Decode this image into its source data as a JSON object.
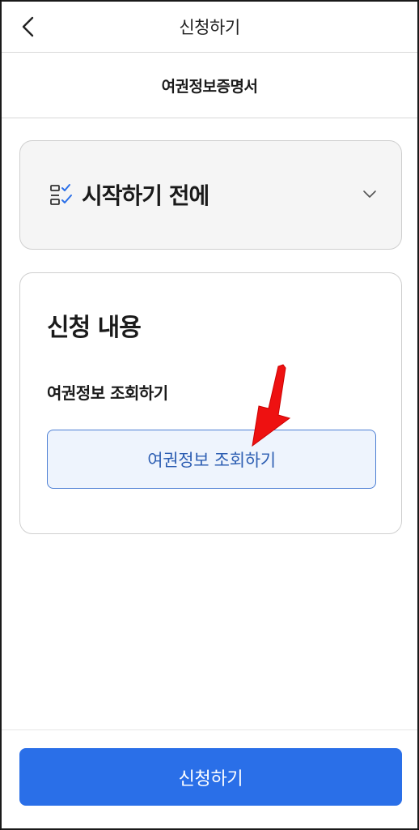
{
  "header": {
    "back_icon": "chevron-left-icon",
    "title": "신청하기"
  },
  "subheader": {
    "title": "여권정보증명서"
  },
  "before_start": {
    "icon": "checklist-icon",
    "label": "시작하기 전에",
    "expand_icon": "chevron-down-icon",
    "expanded": false
  },
  "application": {
    "title": "신청 내용",
    "field_label": "여권정보 조회하기",
    "lookup_button_label": "여권정보 조회하기"
  },
  "footer": {
    "submit_label": "신청하기"
  },
  "annotation": {
    "icon": "red-arrow-pointer"
  },
  "colors": {
    "primary": "#2a6fe8",
    "lookup_bg": "#eef4fd",
    "lookup_border": "#4d7fd4",
    "lookup_text": "#2e5fb3",
    "arrow": "#ee1111"
  }
}
